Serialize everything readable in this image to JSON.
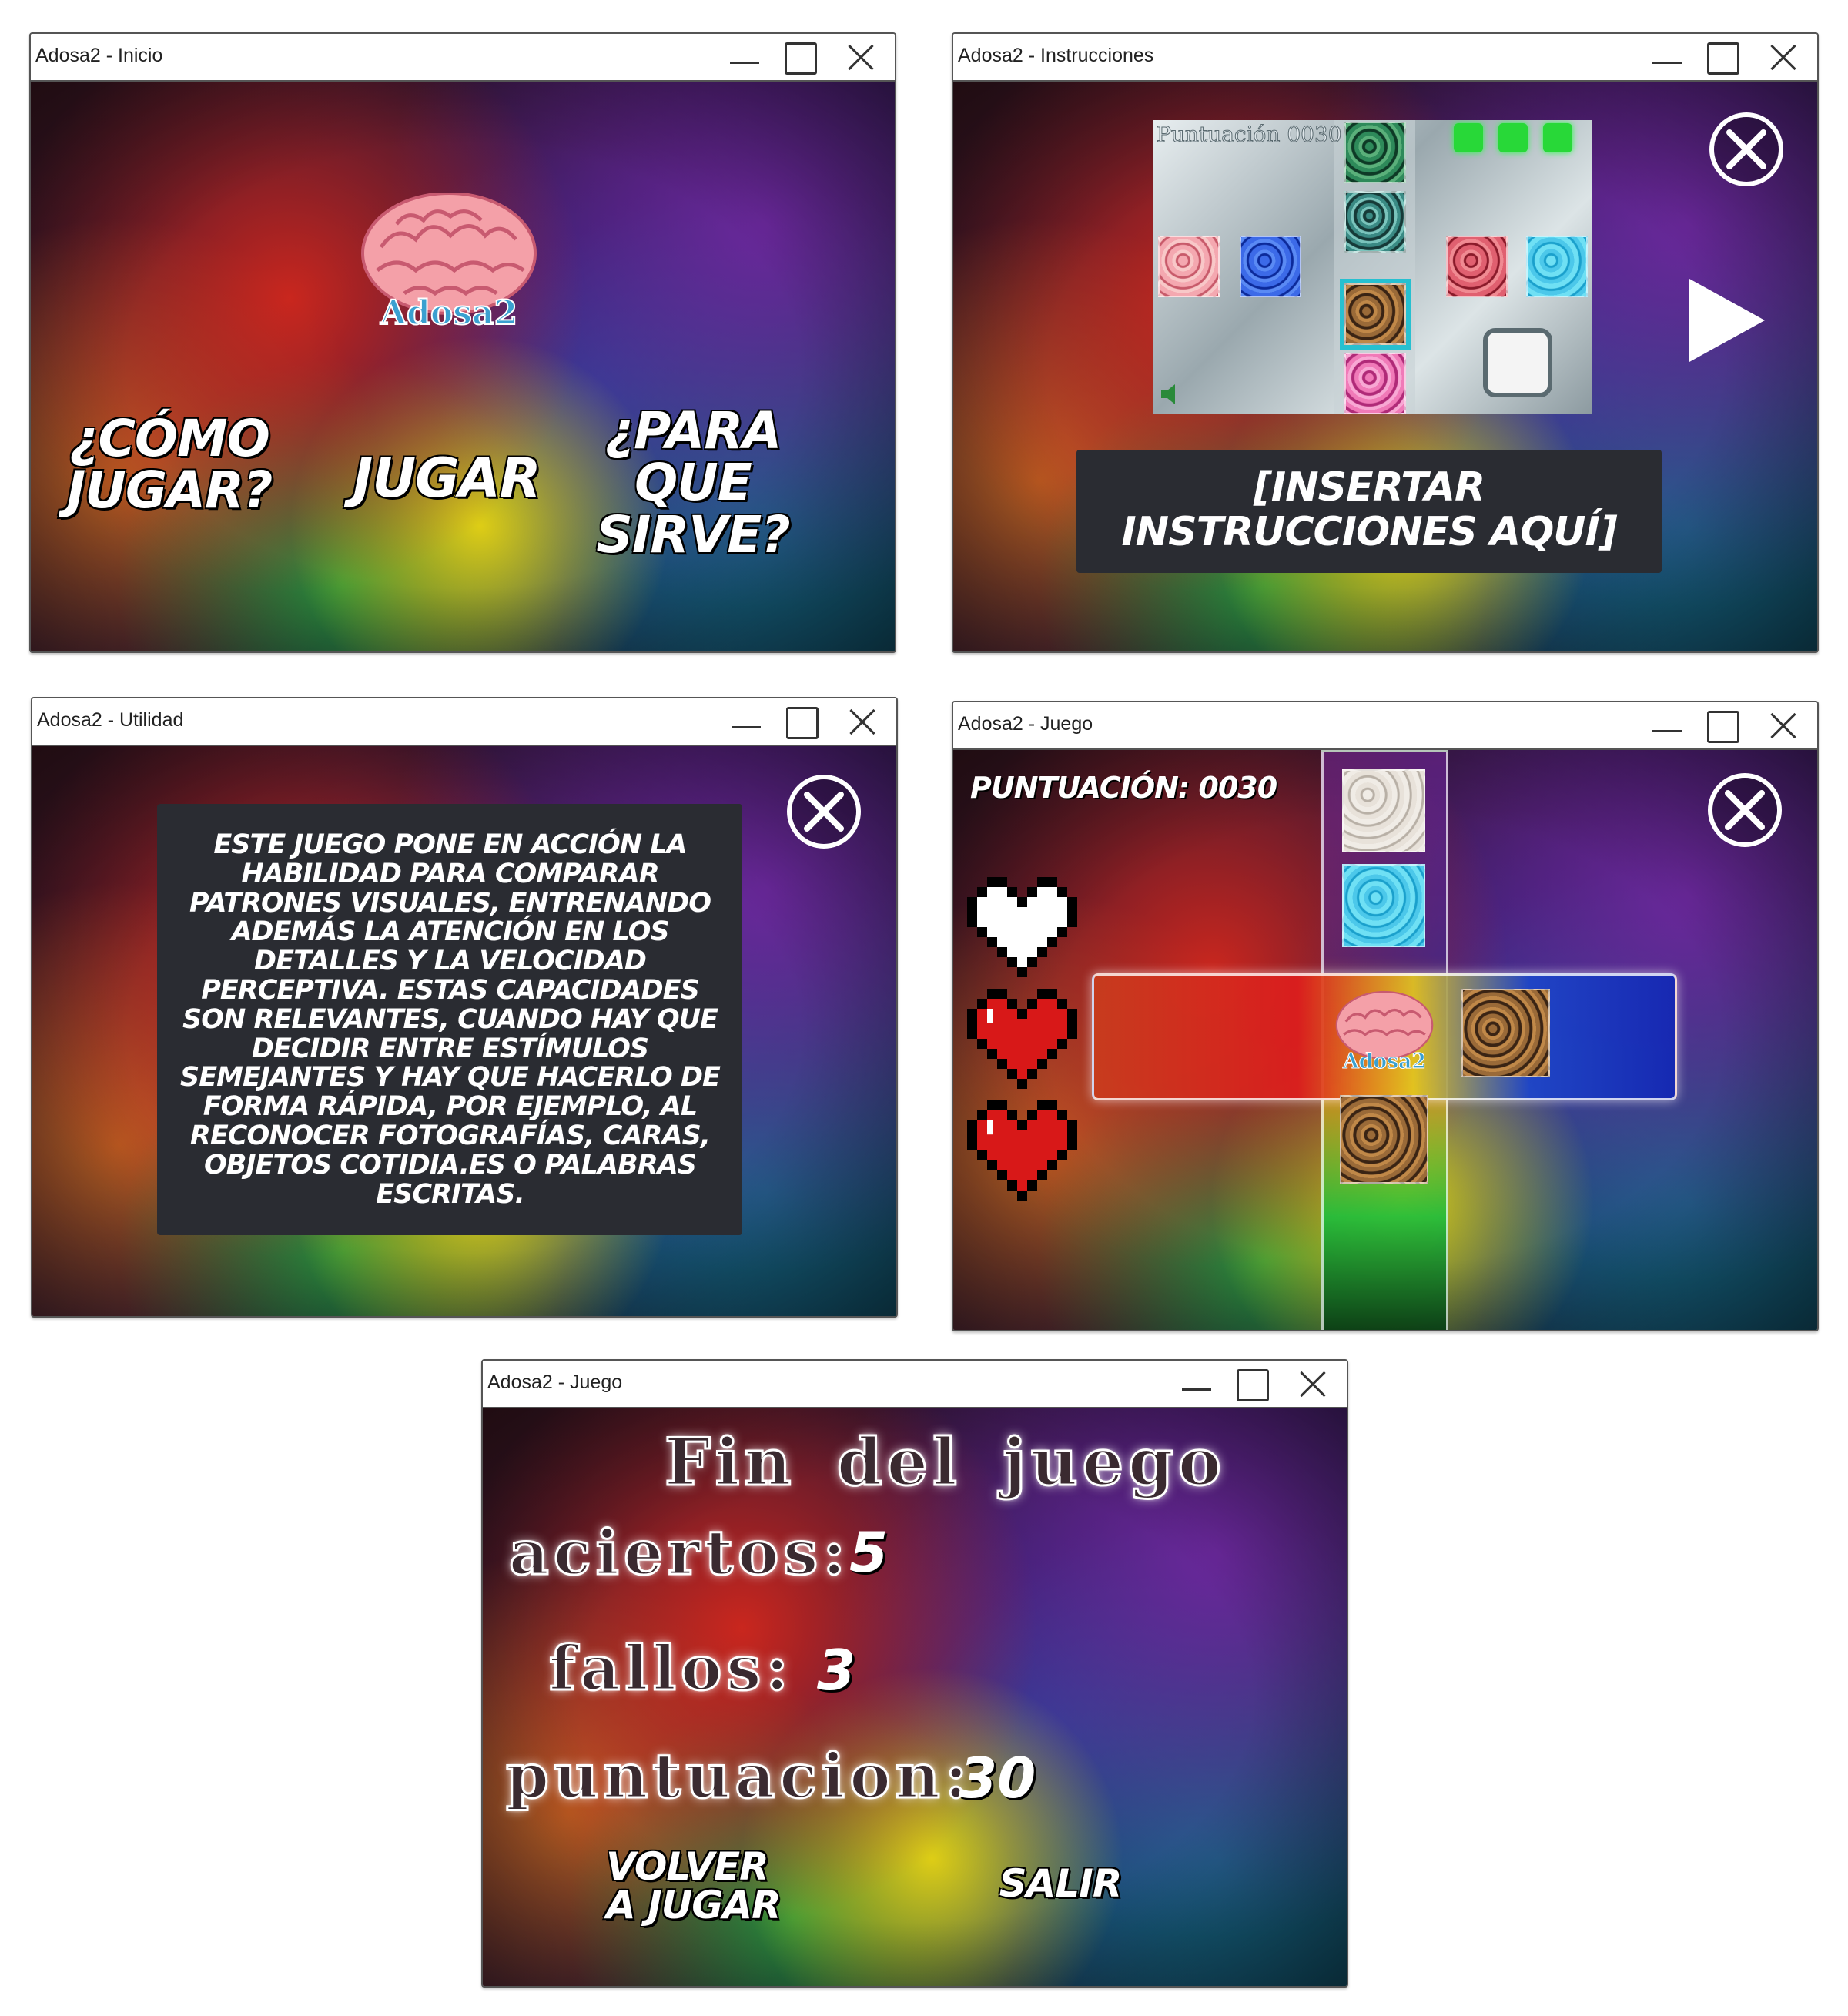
{
  "windows": {
    "inicio": {
      "title": "Adosa2 - Inicio",
      "logo_text": "Adosa2",
      "btn_como": "¿CÓMO JUGAR?",
      "btn_jugar": "JUGAR",
      "btn_para": "¿PARA QUE SIRVE?"
    },
    "instrucciones": {
      "title": "Adosa2 - Instrucciones",
      "preview_score": "Puntuación 0030",
      "placeholder": "[INSERTAR INSTRUCCIONES AQUÍ]",
      "icons": [
        "close-icon",
        "play-icon",
        "speaker-icon"
      ]
    },
    "utilidad": {
      "title": "Adosa2 - Utilidad",
      "body": "ESTE JUEGO PONE EN ACCIÓN LA HABILIDAD PARA COMPARAR PATRONES VISUALES, ENTRENANDO ADEMÁS LA ATENCIÓN EN LOS DETALLES Y LA VELOCIDAD PERCEPTIVA. ESTAS CAPACIDADES SON RELEVANTES, CUANDO HAY QUE DECIDIR ENTRE ESTÍMULOS SEMEJANTES Y HAY QUE HACERLO DE FORMA RÁPIDA, POR EJEMPLO, AL RECONOCER FOTOGRAFÍAS, CARAS, OBJETOS COTIDIA.ES O PALABRAS ESCRITAS."
    },
    "juego": {
      "title": "Adosa2 - Juego",
      "score_label": "PUNTUACIÓN: 0030",
      "lives_total": 3,
      "lives_lost": 1,
      "logo_text": "Adosa2"
    },
    "fin": {
      "title": "Adosa2 - Juego",
      "heading": "Fin del juego",
      "aciertos_label": "aciertos:",
      "aciertos_value": "5",
      "fallos_label": "fallos:",
      "fallos_value": "3",
      "puntuacion_label": "puntuacion:",
      "puntuacion_value": "30",
      "btn_volver": "VOLVER A JUGAR",
      "btn_salir": "SALIR"
    }
  },
  "colors": {
    "panel_dark": "#2a2c32",
    "heart_red": "#d81818",
    "brain_pink": "#f4a0a8"
  }
}
